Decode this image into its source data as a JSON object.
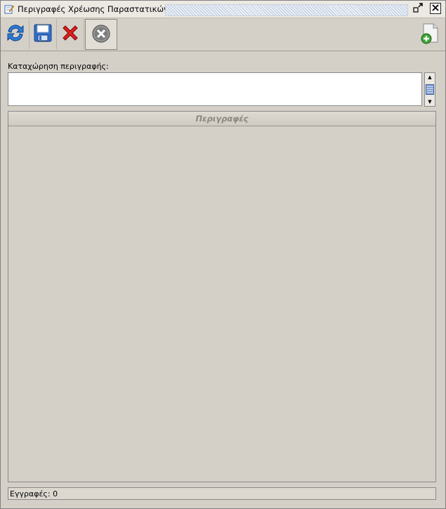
{
  "window": {
    "title": "Περιγραφές Χρέωσης Παραστατικών"
  },
  "toolbar": {
    "buttons": [
      {
        "icon": "refresh-icon"
      },
      {
        "icon": "save-icon"
      },
      {
        "icon": "delete-icon"
      },
      {
        "icon": "cancel-icon"
      },
      {
        "icon": "new-document-icon"
      }
    ]
  },
  "form": {
    "description_label": "Καταχώρηση περιγραφής:",
    "description_value": ""
  },
  "grid": {
    "column_header": "Περιγραφές",
    "rows": []
  },
  "status": {
    "records_text": "Εγγραφές: 0"
  }
}
